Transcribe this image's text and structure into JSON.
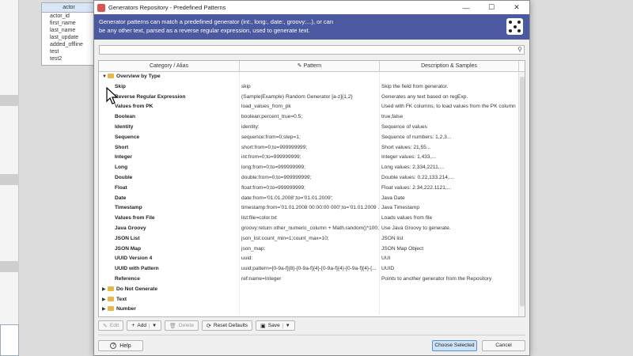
{
  "background": {
    "table_title": "actor",
    "fields": [
      "actor_id",
      "first_name",
      "last_name",
      "last_update",
      "added_offline",
      "test",
      "test2"
    ]
  },
  "dialog": {
    "title": "Generators Repository - Predefined Patterns",
    "window_buttons": {
      "minimize": "—",
      "maximize": "☐",
      "close": "✕"
    },
    "banner_line1": "Generator patterns can match a predefined generator (int:, long:, date:, groovy:...), or can",
    "banner_line2": "be any other text, parsed as a reverse regular expression, used to generate text.",
    "search": {
      "value": "",
      "placeholder": ""
    },
    "columns": {
      "alias": "Category / Alias",
      "pattern": "Pattern",
      "description": "Description & Samples"
    },
    "group_open": "Overview by Type",
    "rows": [
      {
        "alias": "Skip",
        "pattern": "skip",
        "desc": "Skip the field from generator."
      },
      {
        "alias": "Reverse Regular Expression",
        "pattern": "(Sample|Example) Random Generator [a-z]{1,2}",
        "desc": "Generates any text based on regExp."
      },
      {
        "alias": "Values from PK",
        "pattern": "load_values_from_pk",
        "desc": "Used with FK columns, to load values from the PK column"
      },
      {
        "alias": "Boolean",
        "pattern": "boolean:percent_true=0.5;",
        "desc": "true,false"
      },
      {
        "alias": "Identity",
        "pattern": "identity:",
        "desc": "Sequence of values"
      },
      {
        "alias": "Sequence",
        "pattern": "sequence:from=0;step=1;",
        "desc": "Sequence of numbers: 1,2,3..."
      },
      {
        "alias": "Short",
        "pattern": "short:from=0;to=999999999;",
        "desc": "Short values: 21,55..."
      },
      {
        "alias": "Integer",
        "pattern": "int:from=0;to=999999999;",
        "desc": "Integer values: 1,433,..."
      },
      {
        "alias": "Long",
        "pattern": "long:from=0;to=999999999;",
        "desc": "Long values: 2,334,2211,..."
      },
      {
        "alias": "Double",
        "pattern": "double:from=0;to=999999999;",
        "desc": "Double values: 0.22,133.214,..."
      },
      {
        "alias": "Float",
        "pattern": "float:from=0;to=999999999;",
        "desc": "Float values: 2.34,222.1121,..."
      },
      {
        "alias": "Date",
        "pattern": "date:from='01.01.2008';to='01.01.2009';",
        "desc": "Java Date"
      },
      {
        "alias": "Timestamp",
        "pattern": "timestamp:from='01.01.2008 00:00:00 000';to='01.01.2009 ...",
        "desc": "Java Timestamp"
      },
      {
        "alias": "Values from File",
        "pattern": "list:file=color.txt",
        "desc": "Loads values from file"
      },
      {
        "alias": "Java Groovy",
        "pattern": "groovy:return other_numeric_column + Math.random()*100;",
        "desc": "Use Java Groovy to generate."
      },
      {
        "alias": "JSON List",
        "pattern": "json_list:count_min=1;count_max=10;",
        "desc": "JSON list"
      },
      {
        "alias": "JSON Map",
        "pattern": "json_map:",
        "desc": "JSON Map Object"
      },
      {
        "alias": "UUID Version 4",
        "pattern": "uuid:",
        "desc": "UUI"
      },
      {
        "alias": "UUID with Pattern",
        "pattern": "uuid:pattern=[0-9a-f]{8}-[0-9a-f]{4}-[0-9a-f]{4}-[0-9a-f]{4}-[...",
        "desc": "UUID"
      },
      {
        "alias": "Reference",
        "pattern": "ref:name=Integer",
        "desc": "Points to another generator from the Repository"
      }
    ],
    "groups_closed": [
      "Do Not Generate",
      "Text",
      "Number"
    ],
    "toolbar": {
      "edit": "Edit",
      "add": "Add",
      "delete": "Delete",
      "reset": "Reset Defaults",
      "save": "Save"
    },
    "footer": {
      "help": "Help",
      "choose": "Choose Selected",
      "cancel": "Cancel"
    }
  }
}
